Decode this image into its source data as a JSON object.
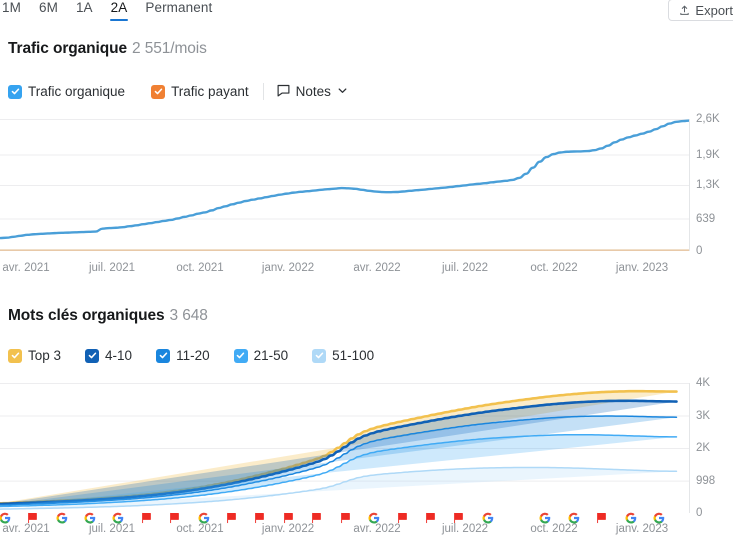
{
  "header": {
    "tabs": [
      {
        "label": "1M",
        "active": false
      },
      {
        "label": "6M",
        "active": false
      },
      {
        "label": "1A",
        "active": false
      },
      {
        "label": "2A",
        "active": true
      },
      {
        "label": "Permanent",
        "active": false
      }
    ],
    "export_label": "Export",
    "export_icon": "upload-icon"
  },
  "traffic": {
    "title": "Trafic organique",
    "value": "2 551/mois",
    "legend": [
      {
        "label": "Trafic organique",
        "color": "#36A3F0",
        "checked": true
      },
      {
        "label": "Trafic payant",
        "color": "#F08033",
        "checked": true
      }
    ],
    "notes_label": "Notes",
    "notes_icon": "speech-bubble-icon",
    "notes_chevron_icon": "chevron-down-icon"
  },
  "keywords": {
    "title": "Mots clés organiques",
    "value": "3 648",
    "legend": [
      {
        "label": "Top 3",
        "color": "#F2C14E",
        "checked": true
      },
      {
        "label": "4-10",
        "color": "#1161B5",
        "checked": true
      },
      {
        "label": "11-20",
        "color": "#1A86DE",
        "checked": true
      },
      {
        "label": "21-50",
        "color": "#41ABF5",
        "checked": true
      },
      {
        "label": "51-100",
        "color": "#AFD9F7",
        "checked": true
      }
    ]
  },
  "chart_data": [
    {
      "type": "line",
      "title": "Trafic organique",
      "ylabel": "",
      "xlabel": "",
      "ylim": [
        0,
        2600
      ],
      "yticks": [
        0,
        639,
        1300,
        1900,
        2600
      ],
      "ytick_labels": [
        "0",
        "639",
        "1,3K",
        "1,9K",
        "2,6K"
      ],
      "grid": true,
      "legend_position": "top-left",
      "xtick_labels": [
        "avr. 2021",
        "juil. 2021",
        "oct. 2021",
        "janv. 2022",
        "avr. 2022",
        "juil. 2022",
        "oct. 2022",
        "janv. 2023"
      ],
      "xtick_positions": [
        26,
        112,
        200,
        288,
        377,
        465,
        554,
        642
      ],
      "series": [
        {
          "name": "Trafic organique",
          "color": "#4A9FD8",
          "values": [
            255,
            262,
            280,
            300,
            318,
            330,
            338,
            345,
            352,
            358,
            362,
            368,
            372,
            378,
            382,
            440,
            452,
            458,
            470,
            488,
            505,
            528,
            548,
            570,
            592,
            612,
            640,
            672,
            700,
            735,
            760,
            800,
            845,
            880,
            920,
            952,
            985,
            1010,
            1035,
            1060,
            1085,
            1110,
            1130,
            1150,
            1165,
            1178,
            1190,
            1205,
            1218,
            1228,
            1240,
            1235,
            1225,
            1205,
            1185,
            1170,
            1160,
            1158,
            1162,
            1172,
            1185,
            1198,
            1208,
            1222,
            1235,
            1248,
            1262,
            1278,
            1292,
            1308,
            1322,
            1335,
            1352,
            1368,
            1382,
            1400,
            1440,
            1520,
            1640,
            1760,
            1850,
            1908,
            1940,
            1955,
            1960,
            1962,
            1968,
            1985,
            2020,
            2075,
            2140,
            2195,
            2240,
            2275,
            2310,
            2350,
            2400,
            2455,
            2510,
            2545,
            2560,
            2570
          ]
        },
        {
          "name": "Trafic payant",
          "color": "#E8C9A8",
          "values": [
            8,
            8,
            8,
            8,
            8,
            8,
            8,
            8,
            8,
            8,
            8,
            8,
            8,
            8,
            8,
            8,
            8,
            8,
            8,
            8,
            8,
            8,
            8,
            8,
            8,
            8,
            8,
            8,
            8,
            8,
            8,
            8,
            8,
            8,
            8,
            8,
            8,
            8,
            8,
            8,
            8,
            8,
            8,
            8,
            8,
            8,
            8,
            8,
            8,
            8,
            8,
            8,
            8,
            8,
            8,
            8,
            8,
            8,
            8,
            8,
            8,
            8,
            8,
            8,
            8,
            8,
            8,
            8,
            8,
            8,
            8,
            8,
            8,
            8,
            8,
            8,
            8,
            8,
            8,
            8,
            8,
            8,
            8,
            8,
            8,
            8,
            8,
            8,
            8,
            8,
            8,
            8,
            8,
            8,
            8,
            8,
            8,
            8,
            8,
            8,
            8,
            8
          ]
        }
      ]
    },
    {
      "type": "area",
      "title": "Mots clés organiques",
      "ylabel": "",
      "xlabel": "",
      "ylim": [
        0,
        4000
      ],
      "yticks": [
        0,
        998,
        2000,
        3000,
        4000
      ],
      "ytick_labels": [
        "0",
        "998",
        "2K",
        "3K",
        "4K"
      ],
      "grid": true,
      "stacked": true,
      "legend_position": "top-left",
      "xtick_labels": [
        "avr. 2021",
        "juil. 2021",
        "oct. 2021",
        "janv. 2022",
        "avr. 2022",
        "juil. 2022",
        "oct. 2022",
        "janv. 2023"
      ],
      "xtick_positions": [
        26,
        112,
        200,
        288,
        377,
        465,
        554,
        642
      ],
      "series": [
        {
          "name": "Top 3",
          "color": "#F2C14E",
          "values": [
            18,
            18,
            19,
            20,
            20,
            21,
            22,
            22,
            23,
            24,
            25,
            25,
            26,
            27,
            28,
            29,
            30,
            31,
            32,
            33,
            34,
            35,
            36,
            38,
            40,
            42,
            44,
            46,
            48,
            50,
            52,
            55,
            58,
            60,
            63,
            65,
            68,
            70,
            73,
            75,
            78,
            80,
            82,
            85,
            88,
            90,
            93,
            96,
            100,
            105,
            110,
            116,
            122,
            128,
            133,
            138,
            142,
            146,
            150,
            154,
            158,
            162,
            166,
            170,
            174,
            178,
            182,
            186,
            190,
            195,
            200,
            205,
            210,
            214,
            218,
            222,
            226,
            230,
            234,
            238,
            242,
            246,
            250,
            254,
            258,
            262,
            266,
            270,
            274,
            278,
            282,
            286,
            290,
            294,
            298,
            300,
            302,
            304,
            305,
            306,
            307,
            308,
            308
          ]
        },
        {
          "name": "4-10",
          "color": "#1161B5",
          "values": [
            35,
            35,
            36,
            37,
            38,
            39,
            40,
            41,
            42,
            43,
            44,
            45,
            46,
            47,
            48,
            50,
            51,
            52,
            54,
            56,
            58,
            60,
            62,
            64,
            67,
            70,
            73,
            76,
            79,
            82,
            86,
            90,
            94,
            98,
            103,
            108,
            113,
            118,
            123,
            128,
            133,
            138,
            143,
            148,
            154,
            160,
            166,
            172,
            180,
            190,
            200,
            212,
            224,
            236,
            246,
            254,
            262,
            268,
            274,
            280,
            286,
            292,
            298,
            304,
            310,
            316,
            322,
            328,
            334,
            340,
            346,
            352,
            358,
            364,
            370,
            376,
            382,
            388,
            394,
            400,
            406,
            412,
            418,
            424,
            430,
            436,
            442,
            448,
            454,
            460,
            464,
            468,
            472,
            476,
            478,
            480,
            481,
            482,
            482,
            482,
            482,
            482,
            482
          ]
        },
        {
          "name": "11-20",
          "color": "#1A86DE",
          "values": [
            45,
            46,
            47,
            48,
            50,
            51,
            52,
            54,
            55,
            57,
            58,
            60,
            61,
            63,
            65,
            67,
            69,
            71,
            73,
            75,
            78,
            80,
            83,
            86,
            89,
            93,
            97,
            101,
            105,
            110,
            115,
            120,
            126,
            132,
            138,
            145,
            152,
            159,
            166,
            173,
            180,
            187,
            194,
            202,
            210,
            218,
            226,
            235,
            246,
            260,
            275,
            292,
            308,
            322,
            334,
            344,
            352,
            360,
            368,
            375,
            382,
            389,
            396,
            403,
            410,
            417,
            424,
            431,
            438,
            445,
            452,
            459,
            466,
            473,
            480,
            487,
            494,
            501,
            508,
            515,
            522,
            529,
            536,
            543,
            550,
            557,
            564,
            570,
            576,
            582,
            588,
            592,
            596,
            600,
            602,
            604,
            605,
            606,
            606,
            606,
            606,
            606,
            606
          ]
        },
        {
          "name": "21-50",
          "color": "#41ABF5",
          "values": [
            80,
            82,
            84,
            86,
            88,
            90,
            93,
            95,
            98,
            100,
            103,
            106,
            109,
            112,
            116,
            120,
            124,
            128,
            132,
            137,
            142,
            147,
            153,
            159,
            165,
            172,
            179,
            187,
            195,
            203,
            212,
            222,
            232,
            243,
            254,
            266,
            278,
            291,
            304,
            318,
            332,
            346,
            361,
            376,
            392,
            408,
            425,
            443,
            465,
            495,
            530,
            570,
            610,
            645,
            672,
            694,
            712,
            726,
            740,
            752,
            764,
            776,
            788,
            800,
            812,
            824,
            836,
            848,
            860,
            872,
            884,
            896,
            906,
            916,
            926,
            936,
            946,
            956,
            966,
            976,
            986,
            996,
            1004,
            1012,
            1020,
            1026,
            1032,
            1038,
            1042,
            1046,
            1050,
            1052,
            1054,
            1056,
            1057,
            1058,
            1058,
            1058,
            1058,
            1058,
            1058
          ]
        },
        {
          "name": "51-100",
          "color": "#AFD9F7",
          "values": [
            120,
            123,
            126,
            130,
            133,
            137,
            141,
            145,
            149,
            154,
            159,
            164,
            169,
            175,
            181,
            187,
            194,
            201,
            208,
            216,
            224,
            233,
            242,
            252,
            262,
            273,
            285,
            297,
            310,
            324,
            338,
            353,
            369,
            386,
            404,
            423,
            443,
            464,
            486,
            509,
            533,
            558,
            584,
            611,
            639,
            668,
            698,
            730,
            770,
            825,
            890,
            960,
            1030,
            1088,
            1130,
            1162,
            1186,
            1206,
            1224,
            1240,
            1256,
            1272,
            1286,
            1300,
            1314,
            1326,
            1338,
            1348,
            1358,
            1366,
            1374,
            1380,
            1386,
            1390,
            1394,
            1396,
            1398,
            1399,
            1400,
            1400,
            1400,
            1398,
            1396,
            1392,
            1388,
            1382,
            1376,
            1370,
            1362,
            1354,
            1346,
            1338,
            1330,
            1322,
            1314,
            1306,
            1298,
            1292,
            1288,
            1286,
            1284
          ]
        }
      ],
      "markers": [
        {
          "x": 5,
          "type": "google"
        },
        {
          "x": 33,
          "type": "flag"
        },
        {
          "x": 62,
          "type": "google"
        },
        {
          "x": 90,
          "type": "google"
        },
        {
          "x": 118,
          "type": "google"
        },
        {
          "x": 147,
          "type": "flag"
        },
        {
          "x": 175,
          "type": "flag"
        },
        {
          "x": 204,
          "type": "google"
        },
        {
          "x": 232,
          "type": "flag"
        },
        {
          "x": 260,
          "type": "flag"
        },
        {
          "x": 289,
          "type": "flag"
        },
        {
          "x": 317,
          "type": "flag"
        },
        {
          "x": 346,
          "type": "flag"
        },
        {
          "x": 374,
          "type": "google"
        },
        {
          "x": 403,
          "type": "flag"
        },
        {
          "x": 431,
          "type": "flag"
        },
        {
          "x": 459,
          "type": "flag"
        },
        {
          "x": 488,
          "type": "google"
        },
        {
          "x": 545,
          "type": "google"
        },
        {
          "x": 574,
          "type": "google"
        },
        {
          "x": 602,
          "type": "flag"
        },
        {
          "x": 631,
          "type": "google"
        },
        {
          "x": 659,
          "type": "google"
        }
      ]
    }
  ]
}
